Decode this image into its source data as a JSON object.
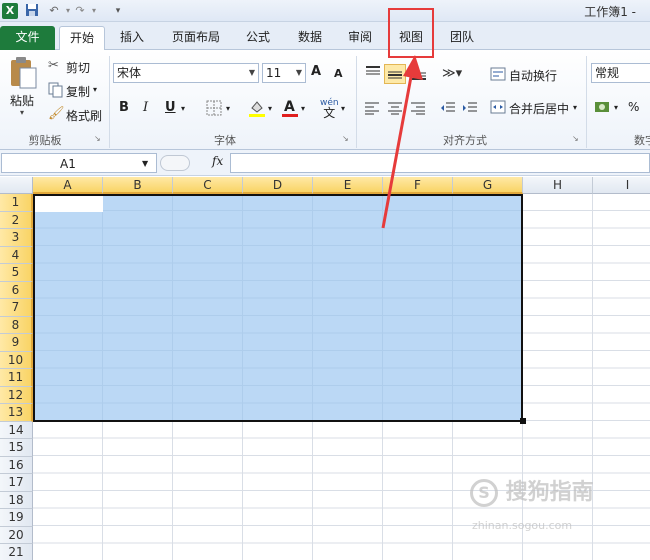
{
  "app": {
    "title": "工作簿1 -"
  },
  "quick_access": {
    "excel_icon": "X",
    "save_icon": "save-icon",
    "undo_icon": "undo-icon",
    "redo_icon": "redo-icon",
    "customize_icon": "▾"
  },
  "tabs": [
    {
      "label": "文件"
    },
    {
      "label": "开始"
    },
    {
      "label": "插入"
    },
    {
      "label": "页面布局"
    },
    {
      "label": "公式"
    },
    {
      "label": "数据"
    },
    {
      "label": "审阅"
    },
    {
      "label": "视图"
    },
    {
      "label": "团队"
    }
  ],
  "clipboard": {
    "paste": "粘贴",
    "cut": "剪切",
    "copy": "复制",
    "format_painter": "格式刷",
    "group": "剪贴板"
  },
  "font": {
    "name": "宋体",
    "size": "11",
    "bold": "B",
    "italic": "I",
    "underline": "U",
    "group": "字体",
    "grow": "A",
    "shrink": "A",
    "phonetic": "wén"
  },
  "alignment": {
    "wrap": "自动换行",
    "merge": "合并后居中",
    "group": "对齐方式"
  },
  "number": {
    "format": "常规",
    "percent": "%",
    "group": "数字"
  },
  "formula_bar": {
    "namebox": "A1",
    "fx": "fx",
    "value": ""
  },
  "columns": [
    "A",
    "B",
    "C",
    "D",
    "E",
    "F",
    "G",
    "H",
    "I"
  ],
  "rows": [
    "1",
    "2",
    "3",
    "4",
    "5",
    "6",
    "7",
    "8",
    "9",
    "10",
    "11",
    "12",
    "13",
    "14",
    "15",
    "16",
    "17",
    "18",
    "19",
    "20",
    "21"
  ],
  "selection": {
    "range": "A1:G13"
  },
  "watermark": {
    "main": "搜狗指南",
    "sub": "zhinan.sogou.com"
  },
  "colors": {
    "file_tab": "#1e7b3c",
    "selection": "#97c3f0",
    "annotation": "#e63b3b",
    "header_selected": "#f9d466"
  }
}
